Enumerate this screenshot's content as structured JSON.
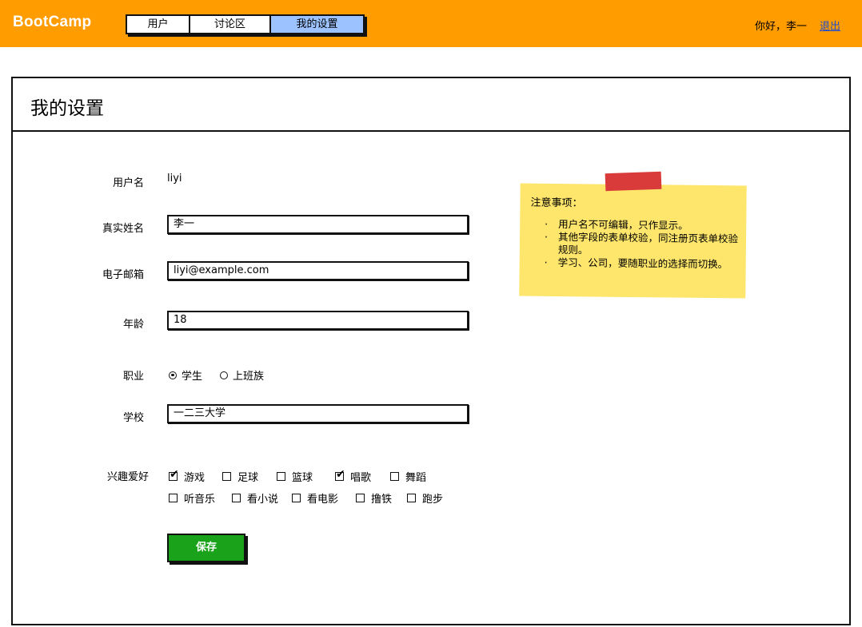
{
  "app": {
    "logo": "BootCamp",
    "nav": [
      {
        "label": "用户",
        "active": false
      },
      {
        "label": "讨论区",
        "active": false
      },
      {
        "label": "我的设置",
        "active": true
      }
    ],
    "greeting": "你好，李一",
    "logout": "退出"
  },
  "page": {
    "title": "我的设置"
  },
  "form": {
    "username_label": "用户名",
    "username_value": "liyi",
    "realname_label": "真实姓名",
    "realname_value": "李一",
    "email_label": "电子邮箱",
    "email_value": "liyi@example.com",
    "age_label": "年龄",
    "age_value": "18",
    "job_label": "职业",
    "job_options": [
      {
        "label": "学生",
        "selected": true
      },
      {
        "label": "上班族",
        "selected": false
      }
    ],
    "school_label": "学校",
    "school_value": "一二三大学",
    "hobby_label": "兴趣爱好",
    "hobbies_row1": [
      {
        "label": "游戏",
        "checked": true
      },
      {
        "label": "足球",
        "checked": false
      },
      {
        "label": "篮球",
        "checked": false
      },
      {
        "label": "唱歌",
        "checked": true
      },
      {
        "label": "舞蹈",
        "checked": false
      }
    ],
    "hobbies_row2": [
      {
        "label": "听音乐",
        "checked": false
      },
      {
        "label": "看小说",
        "checked": false
      },
      {
        "label": "看电影",
        "checked": false
      },
      {
        "label": "撸铁",
        "checked": false
      },
      {
        "label": "跑步",
        "checked": false
      }
    ],
    "save_label": "保存"
  },
  "note": {
    "title": "注意事项：",
    "items": [
      "用户名不可编辑，只作显示。",
      "其他字段的表单校验，同注册页表单校验规则。",
      "学习、公司，要随职业的选择而切换。"
    ]
  },
  "colors": {
    "topbar": "#ff9c00",
    "active_tab": "#9cc3ff",
    "save_button": "#1aa31a",
    "note": "#fde66b",
    "tape": "#d93b3b",
    "link": "#1f4bd0"
  }
}
